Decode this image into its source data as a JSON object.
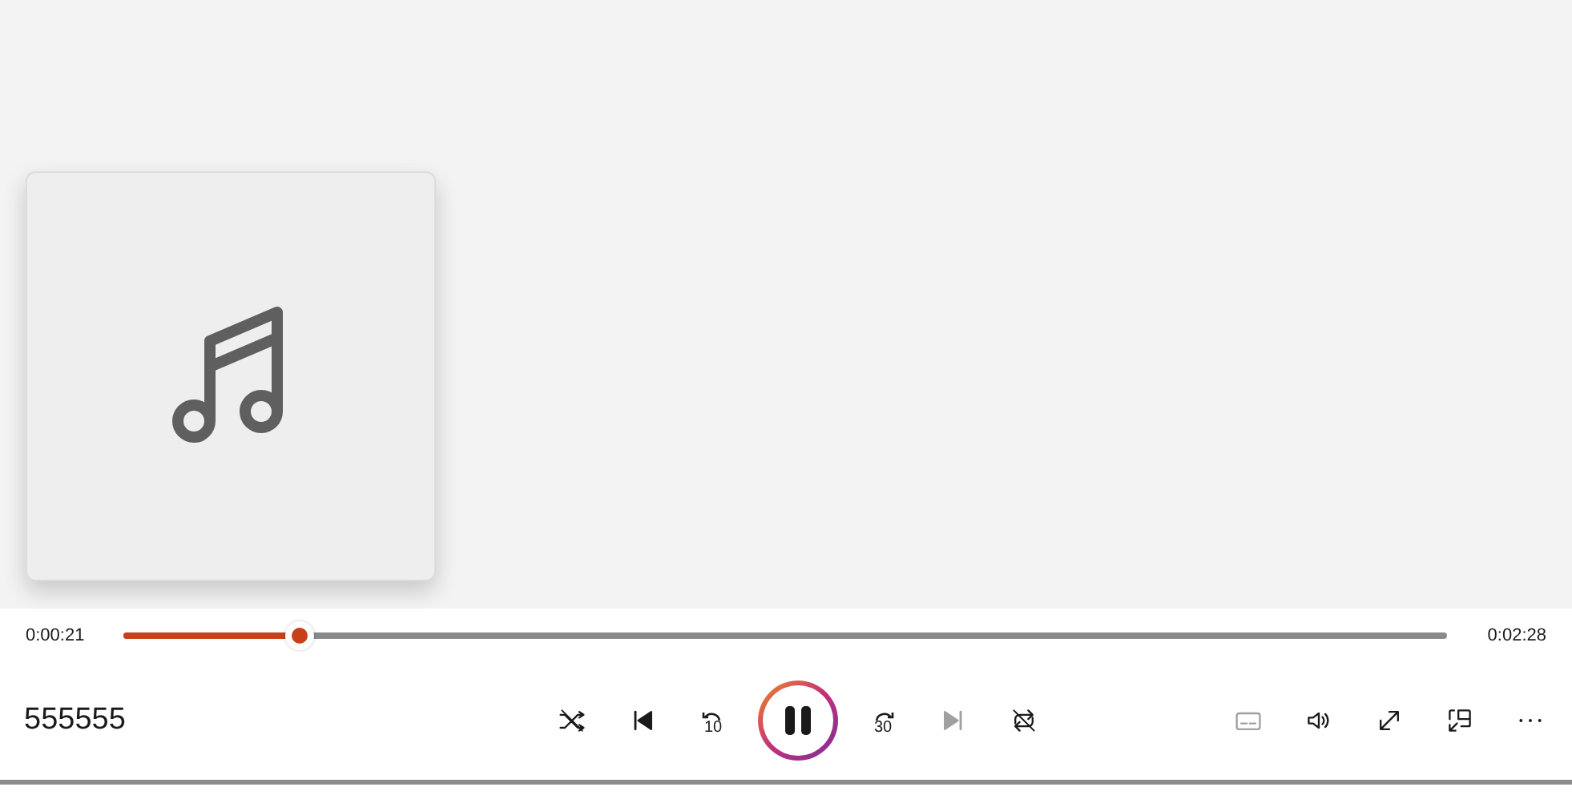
{
  "now_playing": {
    "title": "555555"
  },
  "seek": {
    "elapsed": "0:00:21",
    "duration": "0:02:28",
    "level": 0.133
  },
  "controls": [
    {
      "kind": "shuffle",
      "disabled": false
    },
    {
      "kind": "previous",
      "disabled": false
    },
    {
      "kind": "skip_back",
      "label": "10",
      "disabled": false
    },
    {
      "kind": "pause",
      "disabled": false
    },
    {
      "kind": "skip_forward",
      "label": "30",
      "disabled": false
    },
    {
      "kind": "next",
      "disabled": true
    },
    {
      "kind": "repeat",
      "disabled": false
    }
  ],
  "extra_controls": [
    {
      "kind": "captions",
      "disabled": true
    },
    {
      "kind": "volume",
      "disabled": false
    },
    {
      "kind": "fullscreen",
      "disabled": false
    },
    {
      "kind": "mini_player",
      "disabled": false
    },
    {
      "kind": "more",
      "disabled": false
    }
  ]
}
